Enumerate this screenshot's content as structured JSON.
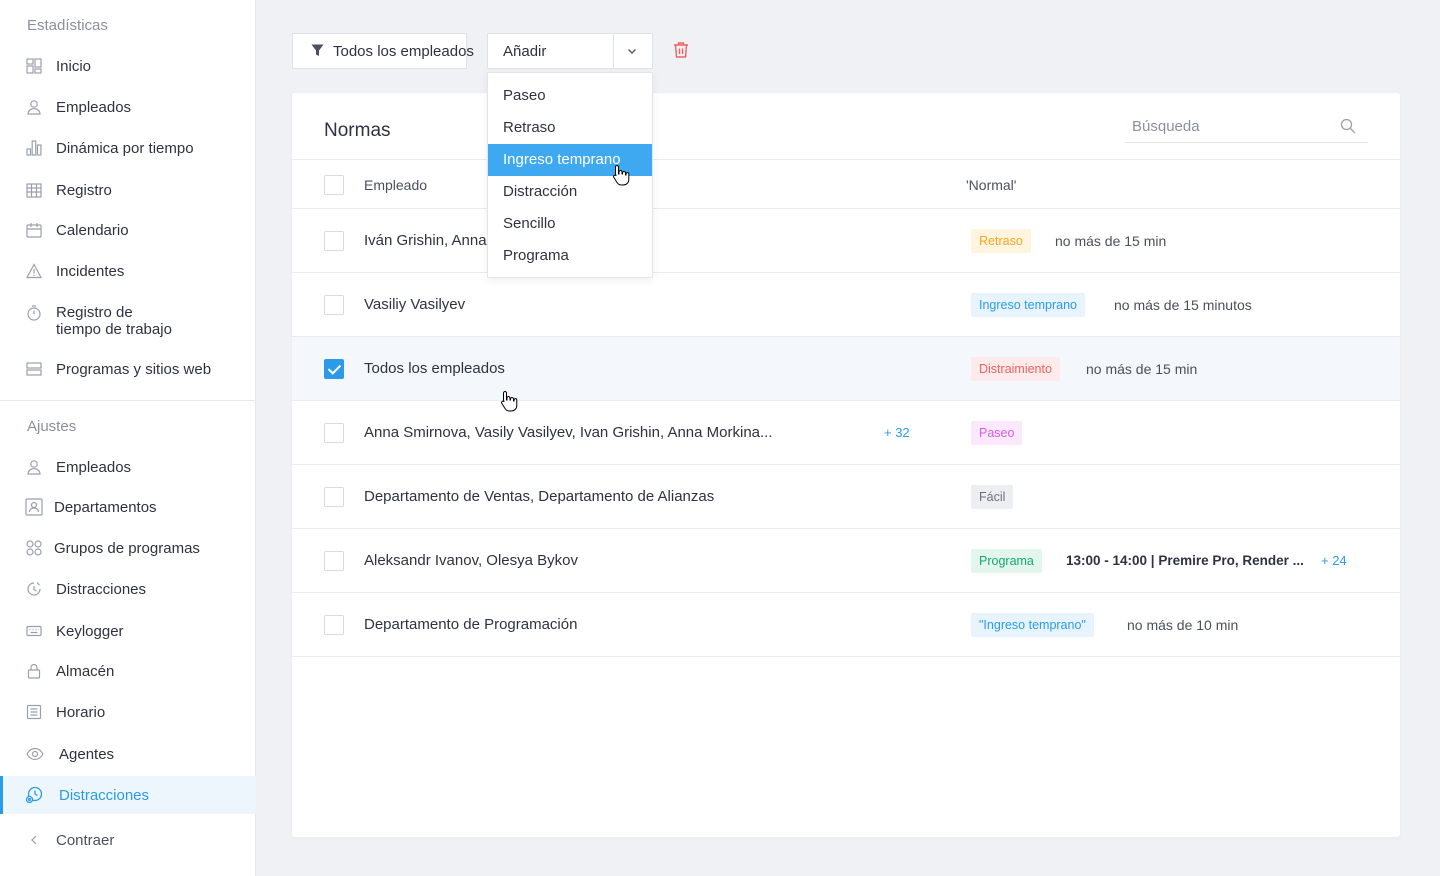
{
  "sidebar": {
    "stats_title": "Estadísticas",
    "stats_items": [
      {
        "label": "Inicio",
        "icon": "dashboard-icon"
      },
      {
        "label": "Empleados",
        "icon": "user-icon"
      },
      {
        "label": "Dinámica por tiempo",
        "icon": "bar-chart-icon"
      },
      {
        "label": "Registro",
        "icon": "grid-calendar-icon"
      },
      {
        "label": "Calendario",
        "icon": "calendar-icon"
      },
      {
        "label": "Incidentes",
        "icon": "warning-icon"
      },
      {
        "label": "Registro de",
        "label2": "tiempo de trabajo",
        "icon": "stopwatch-icon"
      },
      {
        "label": "Programas y sitios web",
        "icon": "layers-icon"
      }
    ],
    "settings_title": "Ajustes",
    "settings_items": [
      {
        "label": "Empleados",
        "icon": "user-icon"
      },
      {
        "label": "Departamentos",
        "icon": "department-icon"
      },
      {
        "label": "Grupos de programas",
        "icon": "app-groups-icon"
      },
      {
        "label": "Distracciones",
        "icon": "clock-distraction-icon"
      },
      {
        "label": "Keylogger",
        "icon": "keyboard-icon"
      },
      {
        "label": "Almacén",
        "icon": "lock-icon"
      },
      {
        "label": "Horario",
        "icon": "schedule-icon"
      },
      {
        "label": "Agentes",
        "icon": "eye-icon"
      },
      {
        "label": "Distracciones",
        "icon": "clock-settings-icon"
      }
    ],
    "collapse_label": "Contraer"
  },
  "toolbar": {
    "filter_label": "Todos los empleados",
    "add_label": "Añadir"
  },
  "dropdown": {
    "items": [
      "Paseo",
      "Retraso",
      "Ingreso temprano",
      "Distracción",
      "Sencillo",
      "Programa"
    ],
    "highlighted": "Ingreso temprano"
  },
  "card": {
    "title": "Normas",
    "search_placeholder": "Búsqueda",
    "col_employee": "Empleado",
    "col_norm": "'Normal'"
  },
  "rows": [
    {
      "employee": "Iván Grishin, Anna",
      "badge": "Retraso",
      "badge_color": "#f5a623",
      "badge_bg": "#fff4de",
      "norm": "no más de 15 min",
      "checked": false
    },
    {
      "employee": "Vasiliy Vasilyev",
      "badge": "Ingreso temprano",
      "badge_color": "#2b9be8",
      "badge_bg": "#e8f4fd",
      "norm": "no más de 15 minutos",
      "checked": false
    },
    {
      "employee": "Todos los empleados",
      "badge": "Distraimiento",
      "badge_color": "#f06262",
      "badge_bg": "#fdeaea",
      "norm": "no más de 15 min",
      "checked": true
    },
    {
      "employee": "Anna Smirnova, Vasily Vasilyev, Ivan Grishin, Anna Morkina...",
      "more": "+ 32",
      "badge": "Paseo",
      "badge_color": "#d65ee3",
      "badge_bg": "#fbe8fd",
      "norm": "",
      "checked": false
    },
    {
      "employee": "Departamento de Ventas, Departamento de Alianzas",
      "badge": "Fácil",
      "badge_color": "#6b717c",
      "badge_bg": "#eceef1",
      "norm": "",
      "checked": false
    },
    {
      "employee": "Aleksandr Ivanov, Olesya Bykov",
      "badge": "Programa",
      "badge_color": "#14a871",
      "badge_bg": "#e2f6ee",
      "norm": "13:00 - 14:00 | Premire Pro, Render ...",
      "norm_more": "+ 24",
      "checked": false
    },
    {
      "employee": "Departamento de Programación",
      "badge": "\"Ingreso temprano\"",
      "badge_color": "#2b9be8",
      "badge_bg": "#e8f4fd",
      "norm": "no más de 10 min",
      "checked": false
    }
  ]
}
